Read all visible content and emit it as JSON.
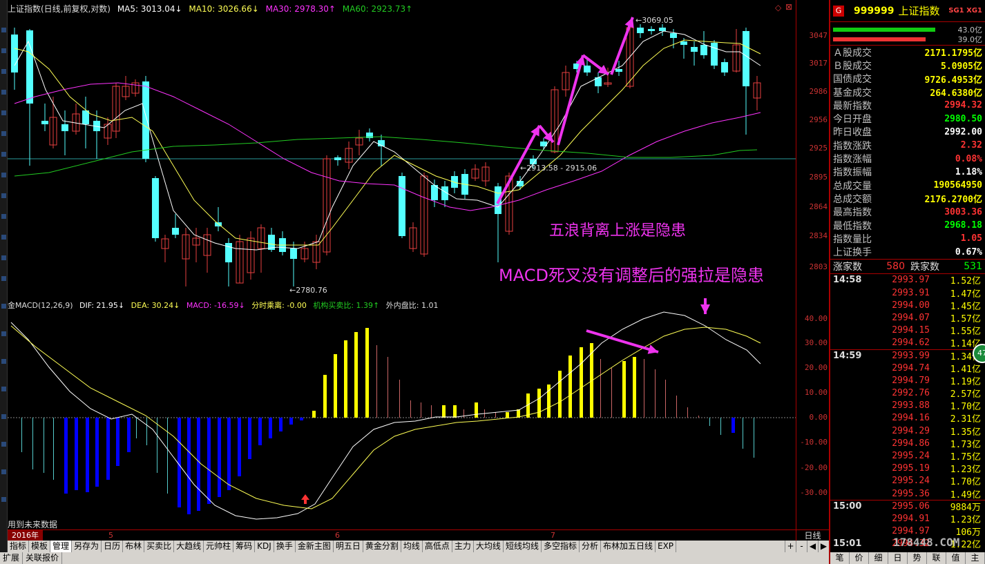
{
  "main": {
    "title": "上证指数(日线,前复权,对数)",
    "ma5": "MA5: 3013.04↓",
    "ma10": "MA10: 3026.66↓",
    "ma30": "MA30: 2978.30↑",
    "ma60": "MA60: 2923.73↑",
    "high_label": "←3069.05",
    "mid_label": "←2913.58 - 2915.06",
    "low_label": "←2780.76",
    "price_axis": [
      "3047",
      "3017",
      "2986",
      "2956",
      "2925",
      "2895",
      "2864",
      "2834",
      "2803"
    ],
    "annotation_1": "五浪背离上涨是隐患",
    "annotation_2": "MACD死叉没有调整后的强拉是隐患",
    "colors": {
      "up": "#e84040",
      "down": "#54ffff",
      "ma5": "#ffffff",
      "ma10": "#ffff55",
      "ma30": "#ff33ff",
      "ma60": "#22cc22",
      "annot": "#ee33ee"
    }
  },
  "macd": {
    "title": "金MACD(12,26,9)",
    "dif": "DIF: 21.95↓",
    "dea": "DEA: 30.24↓",
    "macd": "MACD: -16.59↓",
    "fenshi": "分时乘离: -0.00",
    "jigou": "机构买卖比: 1.39↑",
    "waipan": "外内盘比: 1.01",
    "axis": [
      "40.00",
      "30.00",
      "20.00",
      "10.00",
      "0.00",
      "-10.00",
      "-20.00",
      "-30.00"
    ],
    "future_note": "用到未来数据"
  },
  "date_axis": {
    "year": "2016年",
    "m5": "5",
    "m6": "6",
    "m7": "7",
    "period": "日线"
  },
  "tabs": [
    "指标",
    "模板",
    "管理",
    "另存为",
    "日历",
    "布林",
    "买卖比",
    "大趋线",
    "元帅柱",
    "筹码",
    "KDJ",
    "换手",
    "金新主图",
    "明五日",
    "黄金分割",
    "均线",
    "高低点",
    "主力",
    "大均线",
    "短线均线",
    "多空指标",
    "分析",
    "布林加五日线",
    "EXP"
  ],
  "tab_nav": [
    "+",
    "-",
    "◀",
    "▶"
  ],
  "status": [
    "扩展",
    "关联报价"
  ],
  "quote": {
    "badge": "G",
    "code": "999999",
    "name": "上证指数",
    "sg": "SG1 XG1",
    "bar_up": "43.0亿",
    "bar_down": "39.0亿",
    "rows": [
      {
        "k": "Ａ股成交",
        "v": "2171.1795亿",
        "c": "yellow"
      },
      {
        "k": "Ｂ股成交",
        "v": "5.0905亿",
        "c": "yellow"
      },
      {
        "k": "国债成交",
        "v": "9726.4953亿",
        "c": "yellow"
      },
      {
        "k": "基金成交",
        "v": "264.6380亿",
        "c": "yellow"
      },
      {
        "k": "最新指数",
        "v": "2994.32",
        "c": "red"
      },
      {
        "k": "今日开盘",
        "v": "2980.50",
        "c": "green"
      },
      {
        "k": "昨日收盘",
        "v": "2992.00",
        "c": "white"
      },
      {
        "k": "指数涨跌",
        "v": "2.32",
        "c": "red"
      },
      {
        "k": "指数涨幅",
        "v": "0.08%",
        "c": "red"
      },
      {
        "k": "指数振幅",
        "v": "1.18%",
        "c": "white"
      },
      {
        "k": "总成交量",
        "v": "190564950",
        "c": "yellow"
      },
      {
        "k": "总成交额",
        "v": "2176.2700亿",
        "c": "yellow"
      },
      {
        "k": "最高指数",
        "v": "3003.36",
        "c": "red"
      },
      {
        "k": "最低指数",
        "v": "2968.18",
        "c": "green"
      },
      {
        "k": "指数量比",
        "v": "1.05",
        "c": "red"
      },
      {
        "k": "上证换手",
        "v": "0.67%",
        "c": "white"
      }
    ],
    "up_label": "涨家数",
    "up_count": "580",
    "down_label": "跌家数",
    "down_count": "531",
    "ticks": [
      {
        "t": "14:58",
        "p": "2993.97",
        "v": "1.52亿"
      },
      {
        "t": "",
        "p": "2993.91",
        "v": "1.47亿"
      },
      {
        "t": "",
        "p": "2994.00",
        "v": "1.45亿"
      },
      {
        "t": "",
        "p": "2994.07",
        "v": "1.57亿"
      },
      {
        "t": "",
        "p": "2994.15",
        "v": "1.55亿"
      },
      {
        "t": "",
        "p": "2994.62",
        "v": "1.14亿"
      },
      {
        "t": "14:59",
        "p": "2993.99",
        "v": "1.34亿"
      },
      {
        "t": "",
        "p": "2994.74",
        "v": "1.41亿"
      },
      {
        "t": "",
        "p": "2994.79",
        "v": "1.19亿"
      },
      {
        "t": "",
        "p": "2992.76",
        "v": "2.57亿"
      },
      {
        "t": "",
        "p": "2993.88",
        "v": "1.70亿"
      },
      {
        "t": "",
        "p": "2994.16",
        "v": "2.31亿"
      },
      {
        "t": "",
        "p": "2994.29",
        "v": "1.35亿"
      },
      {
        "t": "",
        "p": "2994.86",
        "v": "1.73亿"
      },
      {
        "t": "",
        "p": "2995.24",
        "v": "1.75亿"
      },
      {
        "t": "",
        "p": "2995.19",
        "v": "1.23亿"
      },
      {
        "t": "",
        "p": "2995.24",
        "v": "1.70亿"
      },
      {
        "t": "",
        "p": "2995.36",
        "v": "1.49亿"
      },
      {
        "t": "15:00",
        "p": "2995.06",
        "v": "9884万"
      },
      {
        "t": "",
        "p": "2994.91",
        "v": "1.23亿"
      },
      {
        "t": "",
        "p": "2994.97",
        "v": "106万"
      },
      {
        "t": "15:01",
        "p": "2994.32",
        "v": "1.22亿"
      }
    ],
    "bottom_tabs": [
      "笔",
      "价",
      "细",
      "日",
      "势",
      "联",
      "值",
      "主"
    ],
    "watermark": "178448.COM",
    "badge_47": "47"
  }
}
